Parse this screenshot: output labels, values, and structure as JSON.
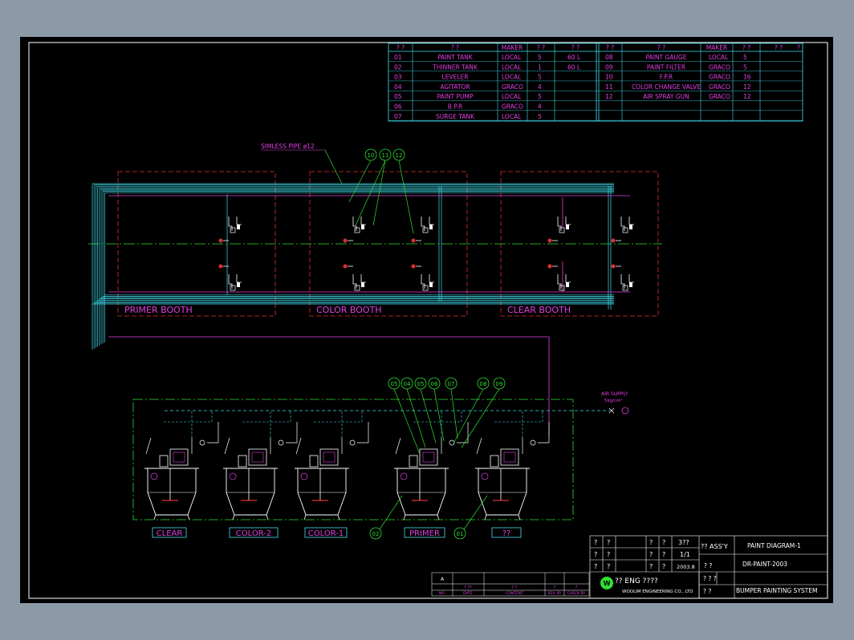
{
  "colors": {
    "frame": "#ffffff",
    "cyan": "#40e0f0",
    "magenta": "#e040e0",
    "red": "#e03030",
    "green": "#30e030",
    "yellow": "#f0f040"
  },
  "parts_table": {
    "header_left": [
      "?  ?",
      "?          ?",
      "MAKER",
      "?   ?",
      "?          ?"
    ],
    "header_right": [
      "?  ?",
      "?          ?",
      "MAKER",
      "?   ?",
      "?   ?",
      "?"
    ],
    "left_rows": [
      {
        "no": "01",
        "name": "PAINT TANK",
        "maker": "LOCAL",
        "qty": "5",
        "rem": "60 L"
      },
      {
        "no": "02",
        "name": "THINNER TANK",
        "maker": "LOCAL",
        "qty": "1",
        "rem": "60 L"
      },
      {
        "no": "03",
        "name": "LEVELER",
        "maker": "LOCAL",
        "qty": "5",
        "rem": ""
      },
      {
        "no": "04",
        "name": "AGITATOR",
        "maker": "GRACO",
        "qty": "4",
        "rem": ""
      },
      {
        "no": "05",
        "name": "PAINT PUMP",
        "maker": "LOCAL",
        "qty": "5",
        "rem": ""
      },
      {
        "no": "06",
        "name": "B.P.R",
        "maker": "GRACO",
        "qty": "4",
        "rem": ""
      },
      {
        "no": "07",
        "name": "SURGE TANK",
        "maker": "LOCAL",
        "qty": "5",
        "rem": ""
      }
    ],
    "right_rows": [
      {
        "no": "08",
        "name": "PAINT GAUGE",
        "maker": "LOCAL",
        "qty": "5"
      },
      {
        "no": "09",
        "name": "PAINT FILTER",
        "maker": "GRACO",
        "qty": "5"
      },
      {
        "no": "10",
        "name": "F.P.R",
        "maker": "GRACO",
        "qty": "16"
      },
      {
        "no": "11",
        "name": "COLOR CHANGE VALVE",
        "maker": "GRACO",
        "qty": "12"
      },
      {
        "no": "12",
        "name": "AIR SPRAY GUN",
        "maker": "GRACO",
        "qty": "12"
      }
    ]
  },
  "pipe_label": "SIMLESS PIPE ø12",
  "booths": [
    "PRIMER BOOTH",
    "COLOR BOOTH",
    "CLEAR BOOTH"
  ],
  "top_callouts": [
    "10",
    "11",
    "12"
  ],
  "tank_callouts": [
    "05",
    "04",
    "05",
    "06",
    "07",
    "08",
    "09"
  ],
  "tanks": [
    "CLEAR",
    "COLOR-2",
    "COLOR-1",
    "PRIMER",
    "??"
  ],
  "bottom_callouts": [
    "02",
    "01"
  ],
  "air_supply": {
    "line1": "AIR SUPPLY",
    "line2": "5kg/cm²"
  },
  "title_block": {
    "q": "?",
    "qq": "? ?",
    "qqq": "? ? ?",
    "val_3": "3??",
    "scale": "1/1",
    "date": "2003.8",
    "assy": "?? ASS'Y",
    "drawing_title": "PAINT DIAGRAM-1",
    "drawing_no": "DR-PAINT-2003",
    "company_logo": "W",
    "company_kr": "?? ENG ????",
    "company_en": "WOOLIM ENGINEERING CO., LTD",
    "project": "BUMPER PAINTING SYSTEM"
  },
  "revision": {
    "mark": "A",
    "labels": [
      "NO.",
      "DATE",
      "CONTENT",
      "REV. BY",
      "CHECK BY"
    ],
    "row": [
      "",
      "?  ??",
      "?   ?",
      "?",
      "?"
    ]
  }
}
